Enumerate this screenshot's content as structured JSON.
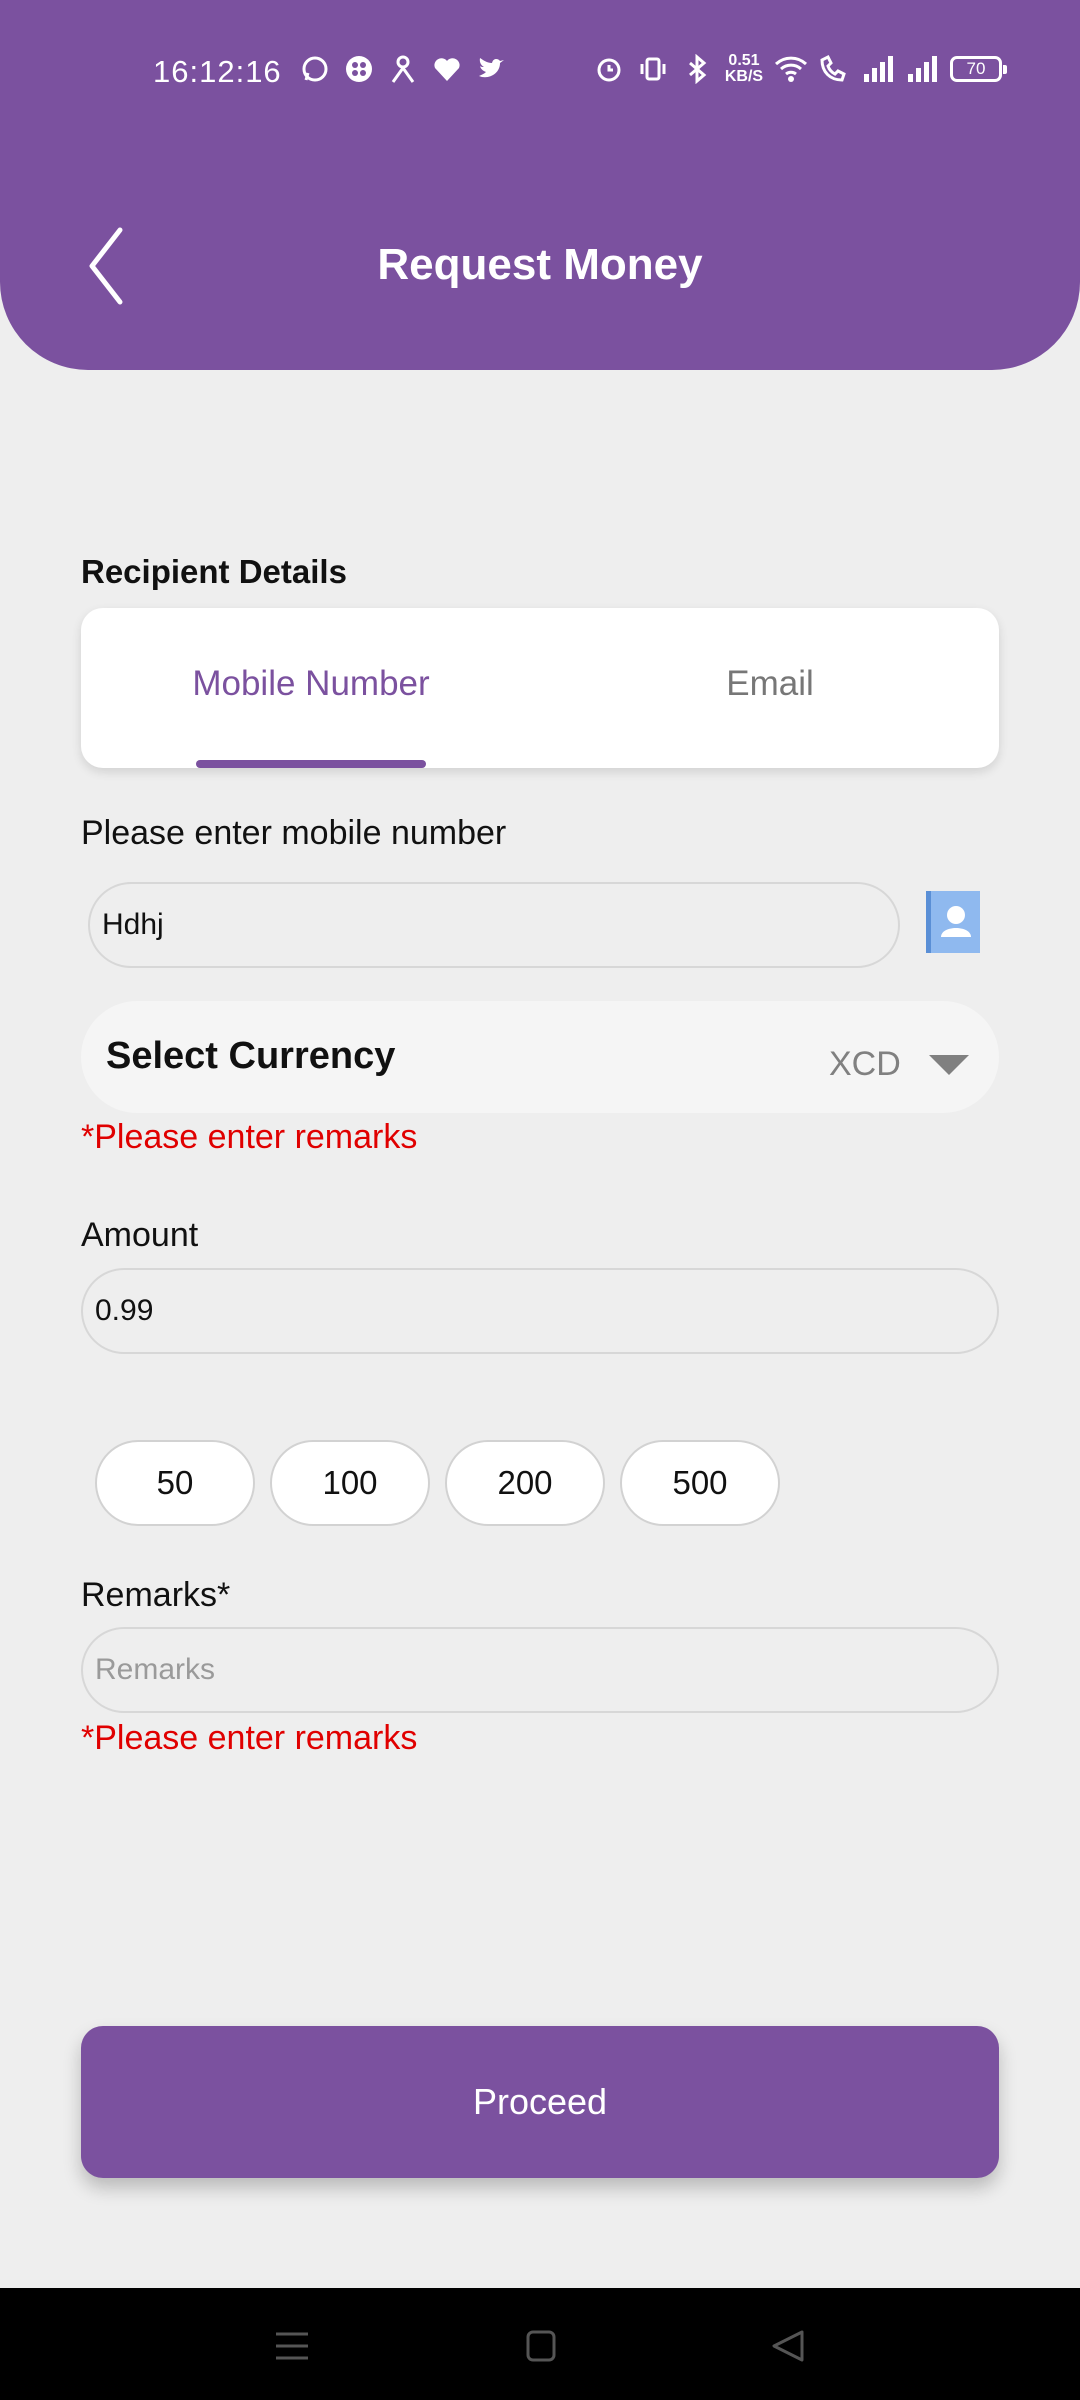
{
  "status_bar": {
    "time": "16:12:16",
    "net_speed_value": "0.51",
    "net_speed_unit": "KB/S",
    "battery": "70",
    "left_icons": [
      "whatsapp-icon",
      "app-icon",
      "app-icon",
      "heart-icon",
      "twitter-icon"
    ],
    "right_icons": [
      "alarm-icon",
      "vibrate-icon",
      "bluetooth-icon",
      "wifi-icon",
      "wifi-call-icon",
      "signal-icon",
      "signal-icon",
      "battery-icon"
    ]
  },
  "header": {
    "title": "Request Money",
    "back_icon": "chevron-left-icon"
  },
  "recipient": {
    "section_label": "Recipient Details",
    "tabs": [
      {
        "label": "Mobile Number",
        "active": true
      },
      {
        "label": "Email",
        "active": false
      }
    ]
  },
  "mobile": {
    "label": "Please enter mobile number",
    "value": "Hdhj",
    "contact_icon": "contact-book-icon"
  },
  "currency": {
    "label": "Select Currency",
    "selected": "XCD",
    "error": "*Please enter remarks"
  },
  "amount": {
    "label": "Amount",
    "value": "0.99",
    "presets": [
      "50",
      "100",
      "200",
      "500"
    ]
  },
  "remarks": {
    "label": "Remarks*",
    "placeholder": "Remarks",
    "value": "",
    "error": "*Please enter remarks"
  },
  "actions": {
    "proceed_label": "Proceed"
  },
  "colors": {
    "brand": "#7b519f",
    "error": "#e00000",
    "background": "#eeeeee"
  }
}
